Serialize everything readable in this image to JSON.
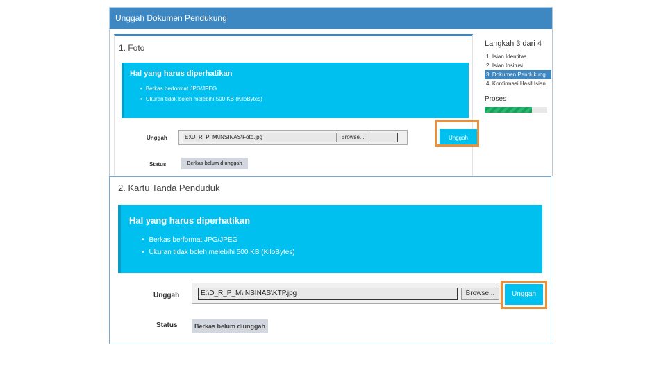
{
  "top": {
    "header_title": "Unggah Dokumen Pendukung",
    "section_title": "1. Foto",
    "alert": {
      "title": "Hal yang harus diperhatikan",
      "items": [
        "Berkas berformat JPG/JPEG",
        "Ukuran tidak boleh melebihi 500 KB (KiloBytes)"
      ]
    },
    "upload_label": "Unggah",
    "file_path": "E:\\D_R_P_M\\INSINAS\\Foto.jpg",
    "browse_label": "Browse...",
    "upload_button": "Unggah",
    "status_label": "Status",
    "status_value": "Berkas belum diunggah",
    "steps": {
      "title": "Langkah 3 dari 4",
      "items": [
        "1. Isian Identitas",
        "2. Isian Insitusi",
        "3. Dokumen Pendukung",
        "4. Konfirmasi Hasil Isian"
      ],
      "active_index": 2
    },
    "progress": {
      "label": "Proses",
      "value_fraction": 0.75
    }
  },
  "bottom": {
    "section_title": "2. Kartu Tanda Penduduk",
    "alert": {
      "title": "Hal yang harus diperhatikan",
      "items": [
        "Berkas berformat JPG/JPEG",
        "Ukuran tidak boleh melebihi 500 KB (KiloBytes)"
      ]
    },
    "upload_label": "Unggah",
    "file_path": "E:\\D_R_P_M\\INSINAS\\KTP.jpg",
    "browse_label": "Browse...",
    "upload_button": "Unggah",
    "status_label": "Status",
    "status_value": "Berkas belum diunggah"
  },
  "colors": {
    "header": "#3d87c2",
    "alert": "#00c0ef",
    "highlight": "#e8913a",
    "progress": "#18a058"
  }
}
